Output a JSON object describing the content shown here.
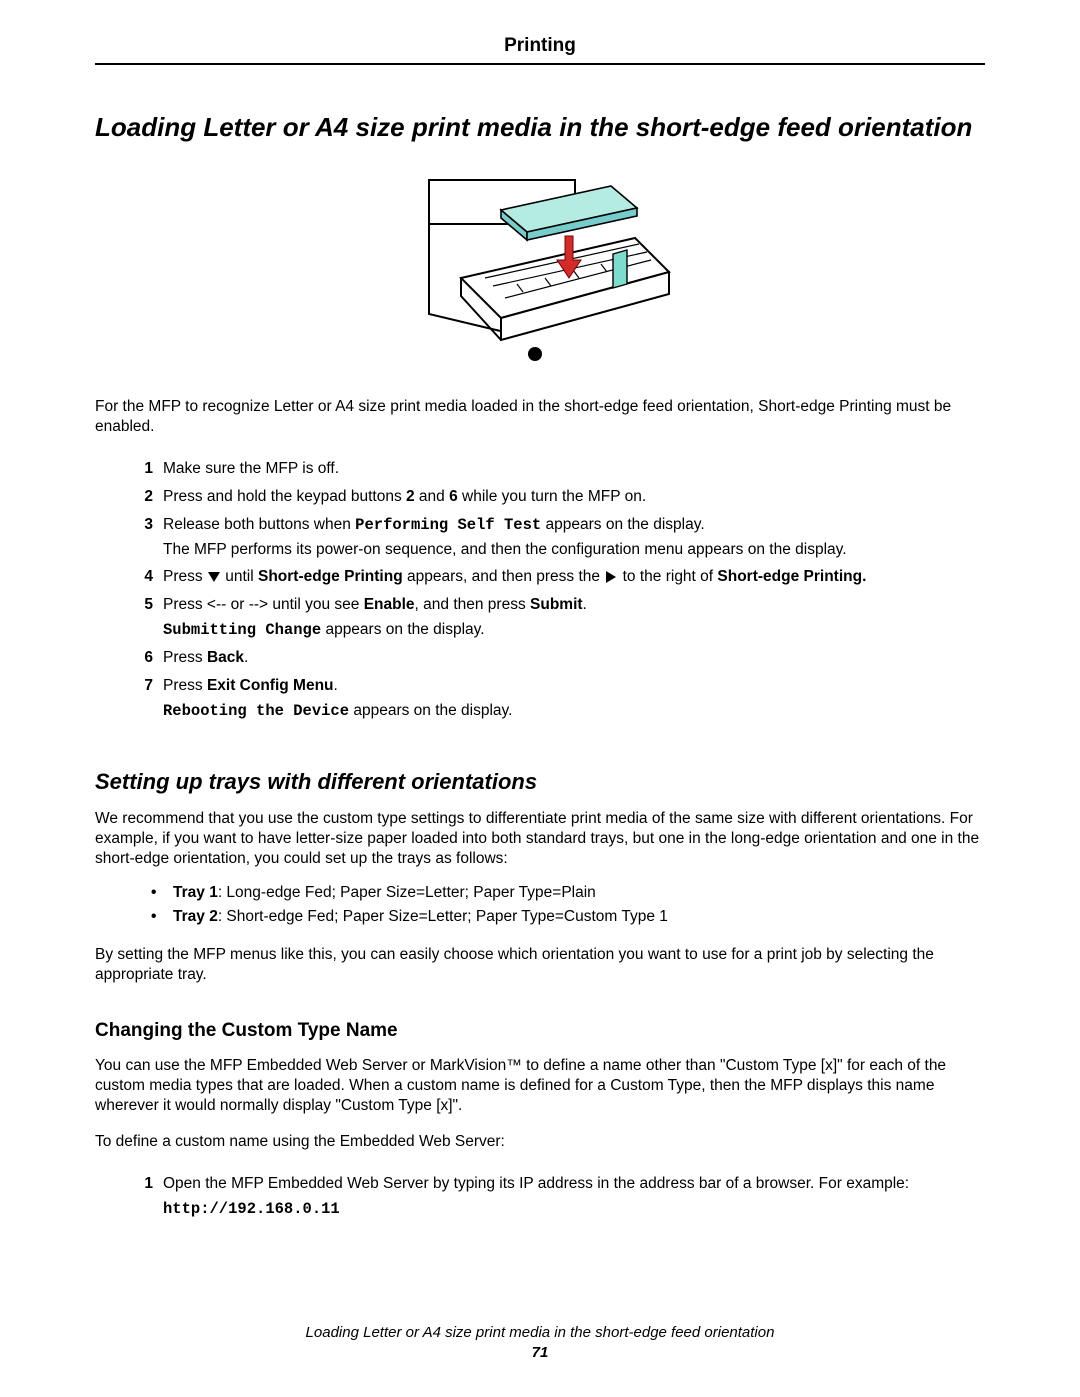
{
  "header": {
    "section_title": "Printing"
  },
  "title": "Loading Letter or A4 size print media in the short-edge feed orientation",
  "intro": "For the MFP to recognize Letter or A4 size print media loaded in the short-edge feed orientation, Short-edge Printing must be enabled.",
  "steps": {
    "s1": {
      "num": "1",
      "p1": "Make sure the MFP is off."
    },
    "s2": {
      "num": "2",
      "p1a": "Press and hold the keypad buttons ",
      "p1b": "2",
      "p1c": " and ",
      "p1d": "6",
      "p1e": " while you turn the MFP on."
    },
    "s3": {
      "num": "3",
      "p1a": "Release both buttons when ",
      "p1mono": "Performing Self Test",
      "p1b": " appears on the display.",
      "p2": "The MFP performs its power-on sequence, and then the configuration menu appears on the display."
    },
    "s4": {
      "num": "4",
      "p1a": "Press ",
      "p1b": " until ",
      "p1c": "Short-edge Printing",
      "p1d": "  appears, and then press the ",
      "p1e": " to the right of ",
      "p1f": "Short-edge Printing."
    },
    "s5": {
      "num": "5",
      "p1a": "Press <-- or --> until you see ",
      "p1b": "Enable",
      "p1c": ", and then press ",
      "p1d": "Submit",
      "p1e": ".",
      "p2mono": "Submitting Change",
      "p2b": " appears on the display."
    },
    "s6": {
      "num": "6",
      "p1a": "Press ",
      "p1b": "Back",
      "p1c": "."
    },
    "s7": {
      "num": "7",
      "p1a": "Press ",
      "p1b": "Exit Config Menu",
      "p1c": ".",
      "p2mono": "Rebooting the Device",
      "p2b": "  appears on the display."
    }
  },
  "section2": {
    "heading": "Setting up trays with different orientations",
    "para1": "We recommend that you use the custom type settings to differentiate print media of the same size with different orientations. For example, if you want to have letter-size paper loaded into both standard trays, but one in the long-edge orientation and one in the short-edge orientation, you could set up the trays as follows:",
    "bullets": {
      "b1": {
        "strong": "Tray 1",
        "rest": ": Long-edge Fed; Paper Size=Letter; Paper Type=Plain"
      },
      "b2": {
        "strong": "Tray 2",
        "rest": ": Short-edge Fed; Paper Size=Letter; Paper Type=Custom Type 1"
      }
    },
    "para2": "By setting the MFP menus like this, you can easily choose which orientation you want to use for a print job by selecting the appropriate tray."
  },
  "section3": {
    "heading": "Changing the Custom Type Name",
    "para1": "You can use the MFP Embedded Web Server or MarkVision™ to define a name other than \"Custom Type [x]\" for each of the custom media types that are loaded. When a custom name is defined for a Custom Type, then the MFP displays this name wherever it would normally display \"Custom Type [x]\".",
    "para2": "To define a custom name using the Embedded Web Server:",
    "steps": {
      "s1": {
        "num": "1",
        "p1": "Open the MFP Embedded Web Server by typing its IP address in the address bar of a browser. For example:",
        "p2mono": "http://192.168.0.11"
      }
    }
  },
  "footer": {
    "caption": "Loading Letter or A4 size print media in the short-edge feed orientation",
    "page": "71"
  }
}
